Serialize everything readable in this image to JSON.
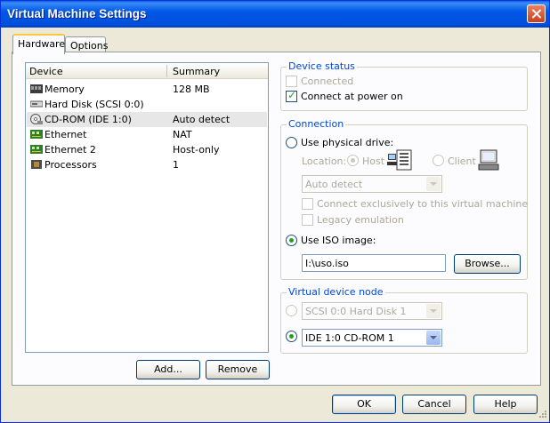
{
  "window": {
    "title": "Virtual Machine Settings"
  },
  "tabs": [
    {
      "label": "Hardware",
      "active": true
    },
    {
      "label": "Options",
      "active": false
    }
  ],
  "device_list": {
    "columns": [
      "Device",
      "Summary"
    ],
    "rows": [
      {
        "device": "Memory",
        "summary": "128 MB",
        "icon": "memory-icon"
      },
      {
        "device": "Hard Disk (SCSI 0:0)",
        "summary": "",
        "icon": "hard-disk-icon"
      },
      {
        "device": "CD-ROM (IDE 1:0)",
        "summary": "Auto detect",
        "icon": "cdrom-icon",
        "selected": true
      },
      {
        "device": "Ethernet",
        "summary": "NAT",
        "icon": "network-card-icon"
      },
      {
        "device": "Ethernet 2",
        "summary": "Host-only",
        "icon": "network-card-icon"
      },
      {
        "device": "Processors",
        "summary": "1",
        "icon": "processor-icon"
      }
    ],
    "add_label": "Add...",
    "remove_label": "Remove"
  },
  "device_status": {
    "label": "Device status",
    "connected": {
      "label": "Connected",
      "checked": false,
      "enabled": false
    },
    "connect_at_power_on": {
      "label": "Connect at power on",
      "checked": true,
      "enabled": true
    }
  },
  "connection": {
    "label": "Connection",
    "physical_drive": {
      "label": "Use physical drive:",
      "selected": false
    },
    "location_label": "Location:",
    "host_label": "Host",
    "client_label": "Client",
    "drive_value": "Auto detect",
    "connect_exclusively": "Connect exclusively to this virtual machine",
    "legacy_emulation": "Legacy emulation",
    "iso_image": {
      "label": "Use ISO image:",
      "selected": true
    },
    "iso_path": "I:\\uso.iso",
    "browse_label": "Browse..."
  },
  "virtual_device_node": {
    "label": "Virtual device node",
    "scsi_value": "SCSI 0:0   Hard Disk 1",
    "ide_value": "IDE 1:0   CD-ROM 1"
  },
  "footer": {
    "ok_label": "OK",
    "cancel_label": "Cancel",
    "help_label": "Help"
  },
  "colors": {
    "title_bar": "#0058e6",
    "group_label": "#0046d5",
    "check_tick": "#21a121",
    "selected_row": "#e7e7e7"
  }
}
